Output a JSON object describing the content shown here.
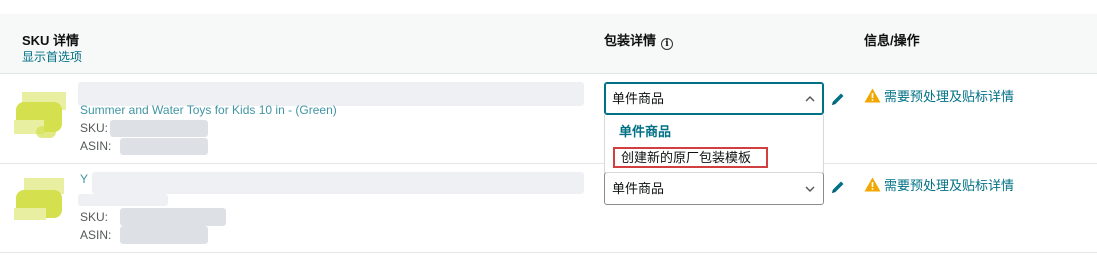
{
  "header": {
    "sku_details": "SKU 详情",
    "show_preferred": "显示首选项",
    "packaging_details": "包装详情",
    "info_icon": "ⓘ",
    "info_actions": "信息/操作"
  },
  "rows": [
    {
      "title_partial": "Summer and Water Toys for Kids 10 in - (Green)",
      "sku_label": "SKU:",
      "asin_label": "ASIN:",
      "package_value": "单件商品",
      "dropdown_open": true,
      "warning_text": "需要预处理及贴标详情"
    },
    {
      "title_partial": "Y",
      "sku_label": "SKU:",
      "asin_label": "ASIN:",
      "package_value": "单件商品",
      "dropdown_open": false,
      "warning_text": "需要预处理及贴标详情"
    }
  ],
  "dropdown": {
    "options": [
      "单件商品",
      "创建新的原厂包装模板"
    ]
  },
  "icons": {
    "pencil": "pencil-icon",
    "warning": "warning-icon",
    "chevron_up": "chevron-up-icon",
    "chevron_down": "chevron-down-icon"
  },
  "colors": {
    "link": "#007185",
    "highlight_border": "#d23f3f",
    "warning": "#f0a800"
  }
}
